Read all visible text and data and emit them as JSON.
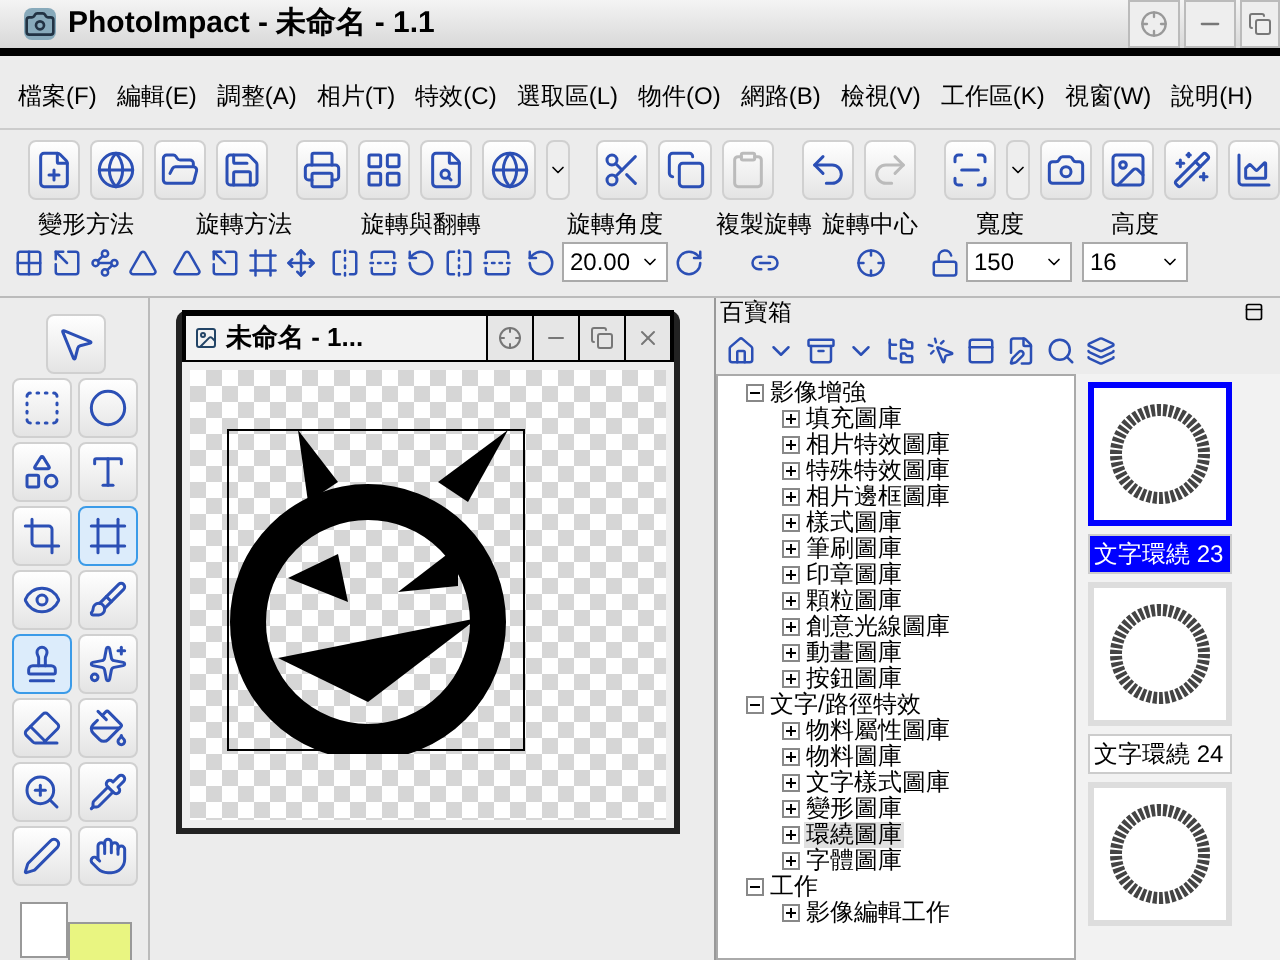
{
  "window": {
    "title": "PhotoImpact - 未命名 - 1.1"
  },
  "menu": [
    "檔案(F)",
    "編輯(E)",
    "調整(A)",
    "相片(T)",
    "特效(C)",
    "選取區(L)",
    "物件(O)",
    "網路(B)",
    "檢視(V)",
    "工作區(K)",
    "視窗(W)",
    "說明(H)"
  ],
  "attribute_bar": [
    {
      "label": "變形方法"
    },
    {
      "label": "旋轉方法"
    },
    {
      "label": "旋轉與翻轉"
    },
    {
      "label": "旋轉角度",
      "value": "20.00"
    },
    {
      "label": "複製旋轉"
    },
    {
      "label": "旋轉中心"
    },
    {
      "label": "寬度",
      "value": "150"
    },
    {
      "label": "高度",
      "value": "16"
    }
  ],
  "tools": [
    {
      "selected": false
    },
    {
      "selected": false
    },
    {
      "selected": false
    },
    {
      "selected": false
    },
    {
      "selected": false
    },
    {
      "selected": false
    },
    {
      "selected": true
    },
    {
      "selected": false
    },
    {
      "selected": false
    },
    {
      "selected": true
    },
    {
      "selected": false
    },
    {
      "selected": false
    },
    {
      "selected": false
    },
    {
      "selected": false
    },
    {
      "selected": false
    },
    {
      "selected": false
    },
    {
      "selected": false
    }
  ],
  "document": {
    "title": "未命名 - 1..."
  },
  "easypalette": {
    "title": "百寶箱",
    "tree": [
      {
        "label": "影像增強",
        "expanded": true,
        "selected": false,
        "children": [
          {
            "label": "填充圖庫",
            "expanded": false,
            "selected": false
          },
          {
            "label": "相片特效圖庫",
            "expanded": false,
            "selected": false
          },
          {
            "label": "特殊特效圖庫",
            "expanded": false,
            "selected": false
          },
          {
            "label": "相片邊框圖庫",
            "expanded": false,
            "selected": false
          },
          {
            "label": "樣式圖庫",
            "expanded": false,
            "selected": false
          },
          {
            "label": "筆刷圖庫",
            "expanded": false,
            "selected": false
          },
          {
            "label": "印章圖庫",
            "expanded": false,
            "selected": false
          },
          {
            "label": "顆粒圖庫",
            "expanded": false,
            "selected": false
          },
          {
            "label": "創意光線圖庫",
            "expanded": false,
            "selected": false
          },
          {
            "label": "動畫圖庫",
            "expanded": false,
            "selected": false
          },
          {
            "label": "按鈕圖庫",
            "expanded": false,
            "selected": false
          }
        ]
      },
      {
        "label": "文字/路徑特效",
        "expanded": true,
        "selected": false,
        "children": [
          {
            "label": "物料屬性圖庫",
            "expanded": false,
            "selected": false
          },
          {
            "label": "物料圖庫",
            "expanded": false,
            "selected": false
          },
          {
            "label": "文字樣式圖庫",
            "expanded": false,
            "selected": false
          },
          {
            "label": "變形圖庫",
            "expanded": false,
            "selected": false
          },
          {
            "label": "環繞圖庫",
            "expanded": false,
            "selected": true
          },
          {
            "label": "字體圖庫",
            "expanded": false,
            "selected": false
          }
        ]
      },
      {
        "label": "工作",
        "expanded": true,
        "selected": false,
        "children": [
          {
            "label": "影像編輯工作",
            "expanded": false,
            "selected": false
          }
        ]
      }
    ],
    "gallery": [
      {
        "label": "文字環繞 23",
        "selected": true
      },
      {
        "label": "文字環繞 24",
        "selected": false
      },
      {
        "selected": false
      }
    ]
  }
}
